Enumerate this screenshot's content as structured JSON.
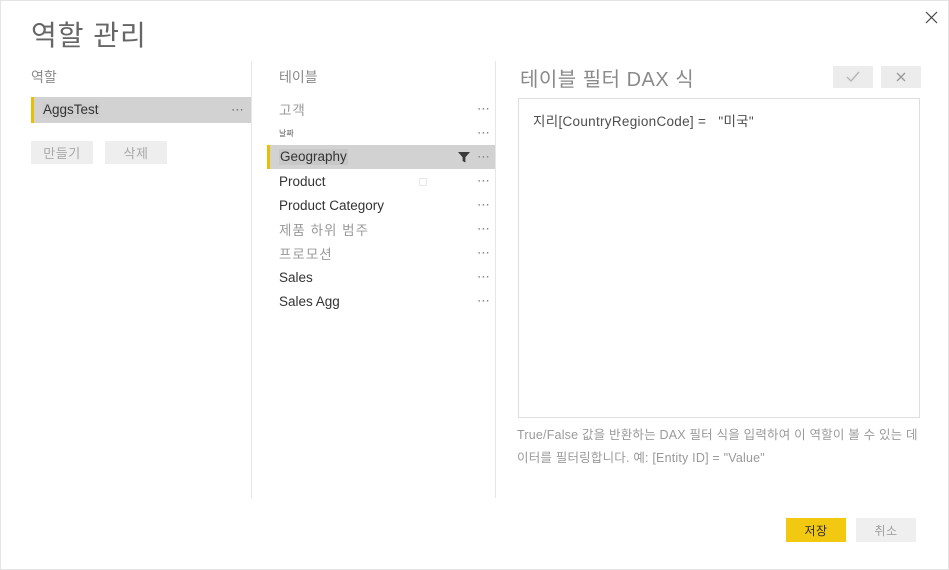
{
  "dialog": {
    "title": "역할 관리",
    "close_icon": "close-icon"
  },
  "roles": {
    "label": "역할",
    "items": [
      {
        "name": "AggsTest",
        "selected": true,
        "menu": "⋯"
      }
    ],
    "create_label": "만들기",
    "delete_label": "삭제"
  },
  "tables": {
    "label": "테이블",
    "items": [
      {
        "name": "고객",
        "style": "korean",
        "selected": false,
        "has_filter": false,
        "menu": "⋯"
      },
      {
        "name": "날짜",
        "style": "tiny",
        "selected": false,
        "has_filter": false,
        "menu": "⋯"
      },
      {
        "name": "Geography",
        "style": "latin",
        "selected": true,
        "has_filter": true,
        "menu": "⋯"
      },
      {
        "name": "Product",
        "style": "latin",
        "selected": false,
        "has_filter": false,
        "menu": "⋯"
      },
      {
        "name": "Product Category",
        "style": "latin",
        "selected": false,
        "has_filter": false,
        "menu": "⋯"
      },
      {
        "name": "제품 하위 범주",
        "style": "korean",
        "selected": false,
        "has_filter": false,
        "menu": "⋯"
      },
      {
        "name": "프로모션",
        "style": "korean",
        "selected": false,
        "has_filter": false,
        "menu": "⋯"
      },
      {
        "name": "Sales",
        "style": "latin",
        "selected": false,
        "has_filter": false,
        "menu": "⋯"
      },
      {
        "name": "Sales Agg",
        "style": "latin",
        "selected": false,
        "has_filter": false,
        "menu": "⋯"
      }
    ]
  },
  "dax": {
    "label": "테이블 필터 DAX 식",
    "accept_icon": "checkmark-icon",
    "reject_icon": "close-icon",
    "expression": "지리[CountryRegionCode] =   \"미국\"",
    "placeholder": "",
    "help_text": "True/False 값을 반환하는 DAX 필터 식을 입력하여 이 역할이 볼 수 있는 데이터를 필터링합니다. 예: [Entity ID] =   \"Value\""
  },
  "footer": {
    "save_label": "저장",
    "cancel_label": "취소"
  },
  "colors": {
    "accent_yellow": "#f2c811",
    "selection_gray": "#d2d2d2",
    "muted_text": "#9a9a9a"
  }
}
